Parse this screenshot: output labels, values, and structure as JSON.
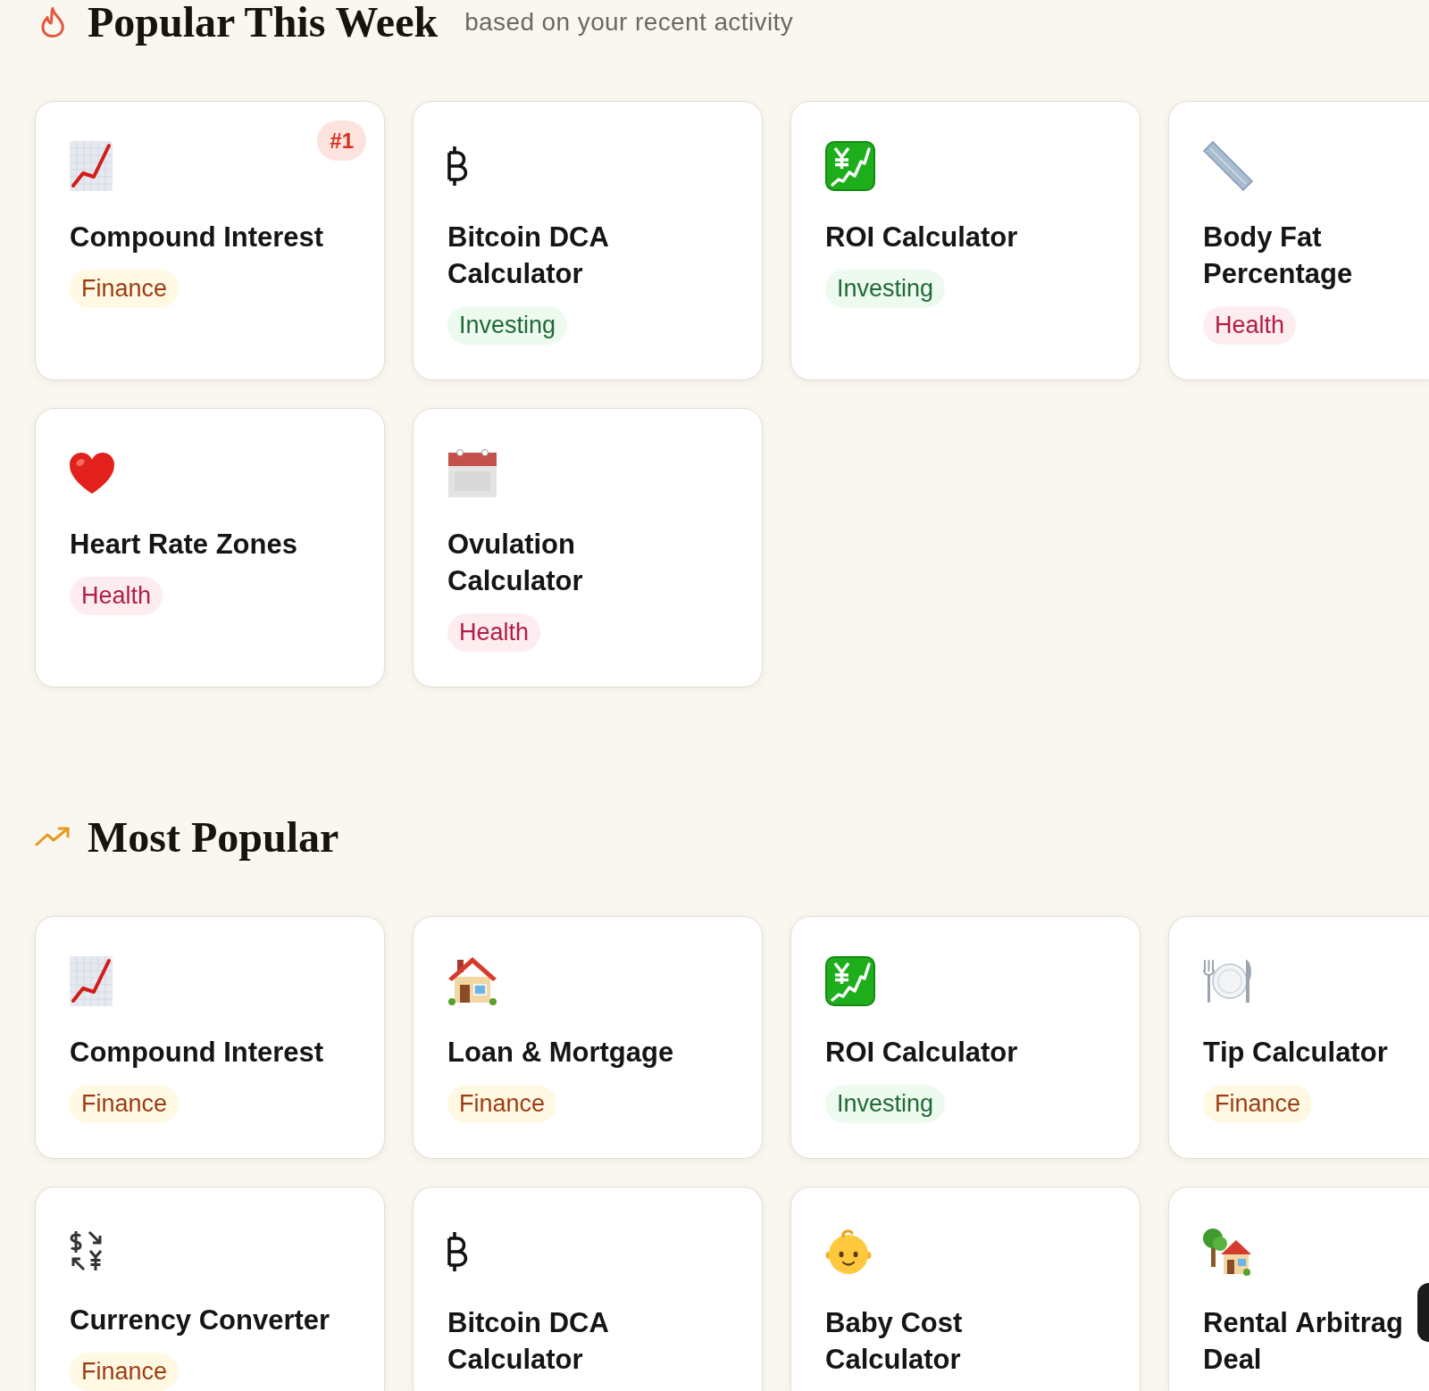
{
  "sections": [
    {
      "title": "Popular This Week",
      "subtitle": "based on your recent activity",
      "cards": [
        {
          "title": "Compound Interest",
          "badge": "#1",
          "tag": {
            "label": "Finance",
            "kind": "finance"
          }
        },
        {
          "title": "Bitcoin DCA Calculator",
          "tag": {
            "label": "Investing",
            "kind": "investing"
          }
        },
        {
          "title": "ROI Calculator",
          "tag": {
            "label": "Investing",
            "kind": "investing"
          }
        },
        {
          "title": "Body Fat Percentage",
          "tag": {
            "label": "Health",
            "kind": "health"
          }
        },
        {
          "title": "Heart Rate Zones",
          "tag": {
            "label": "Health",
            "kind": "health"
          }
        },
        {
          "title": "Ovulation Calculator",
          "tag": {
            "label": "Health",
            "kind": "health"
          }
        }
      ]
    },
    {
      "title": "Most Popular",
      "cards": [
        {
          "title": "Compound Interest",
          "tag": {
            "label": "Finance",
            "kind": "finance"
          }
        },
        {
          "title": "Loan & Mortgage",
          "tag": {
            "label": "Finance",
            "kind": "finance"
          }
        },
        {
          "title": "ROI Calculator",
          "tag": {
            "label": "Investing",
            "kind": "investing"
          }
        },
        {
          "title": "Tip Calculator",
          "tag": {
            "label": "Finance",
            "kind": "finance"
          }
        },
        {
          "title": "Currency Converter",
          "tag": {
            "label": "Finance",
            "kind": "finance"
          }
        },
        {
          "title": "Bitcoin DCA Calculator"
        },
        {
          "title": "Baby Cost Calculator"
        },
        {
          "title": "Rental Arbitrag Deal"
        }
      ]
    }
  ]
}
